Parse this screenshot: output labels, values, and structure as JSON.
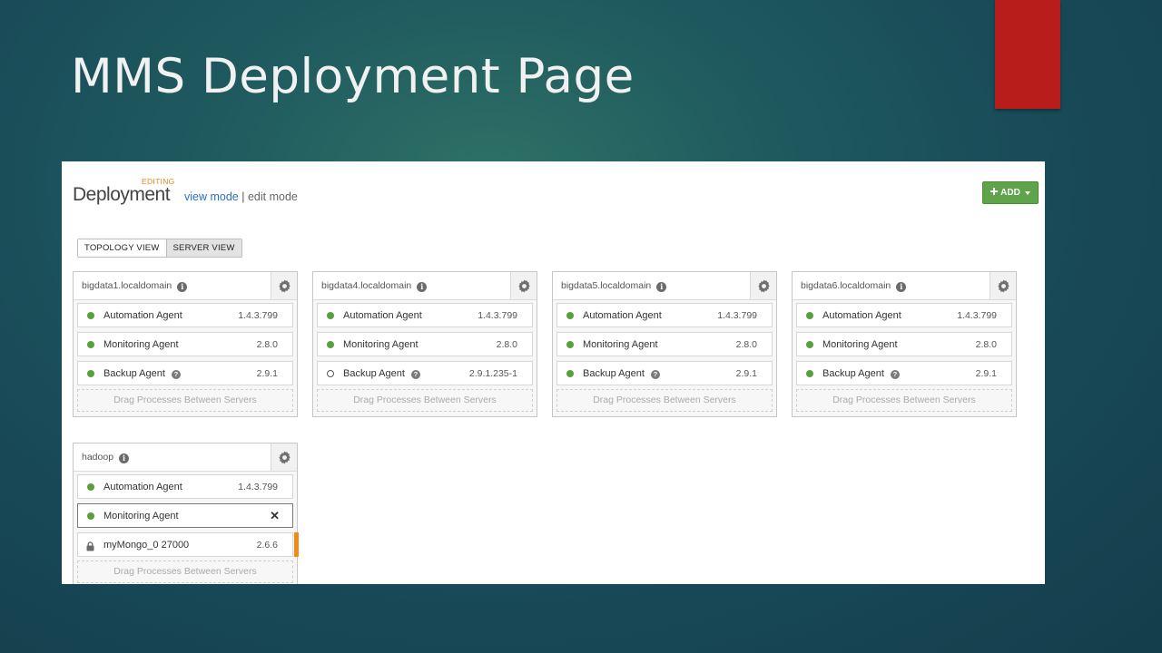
{
  "slide": {
    "title": "MMS Deployment Page"
  },
  "header": {
    "title": "Deployment",
    "badge": "EDITING",
    "view_mode": "view mode",
    "separator": "|",
    "edit_mode": "edit mode",
    "add_label": "ADD"
  },
  "toggle": {
    "topology": "TOPOLOGY VIEW",
    "server": "SERVER VIEW"
  },
  "colors": {
    "accent_green": "#5fa34a",
    "status_green": "#5a9e3e",
    "warning_orange": "#f08a18",
    "brand_red": "#b81d1c"
  },
  "servers": [
    {
      "name": "bigdata1.localdomain",
      "processes": [
        {
          "name": "Automation Agent",
          "version": "1.4.3.799"
        },
        {
          "name": "Monitoring Agent",
          "version": "2.8.0"
        },
        {
          "name": "Backup Agent",
          "version": "2.9.1"
        }
      ],
      "drop": "Drag Processes Between Servers"
    },
    {
      "name": "bigdata4.localdomain",
      "processes": [
        {
          "name": "Automation Agent",
          "version": "1.4.3.799"
        },
        {
          "name": "Monitoring Agent",
          "version": "2.8.0"
        },
        {
          "name": "Backup Agent",
          "version": "2.9.1.235-1"
        }
      ],
      "drop": "Drag Processes Between Servers"
    },
    {
      "name": "bigdata5.localdomain",
      "processes": [
        {
          "name": "Automation Agent",
          "version": "1.4.3.799"
        },
        {
          "name": "Monitoring Agent",
          "version": "2.8.0"
        },
        {
          "name": "Backup Agent",
          "version": "2.9.1"
        }
      ],
      "drop": "Drag Processes Between Servers"
    },
    {
      "name": "bigdata6.localdomain",
      "processes": [
        {
          "name": "Automation Agent",
          "version": "1.4.3.799"
        },
        {
          "name": "Monitoring Agent",
          "version": "2.8.0"
        },
        {
          "name": "Backup Agent",
          "version": "2.9.1"
        }
      ],
      "drop": "Drag Processes Between Servers"
    },
    {
      "name": "hadoop",
      "processes": [
        {
          "name": "Automation Agent",
          "version": "1.4.3.799"
        },
        {
          "name": "Monitoring Agent"
        },
        {
          "name": "myMongo_0 27000",
          "version": "2.6.6"
        }
      ],
      "drop": "Drag Processes Between Servers"
    }
  ]
}
